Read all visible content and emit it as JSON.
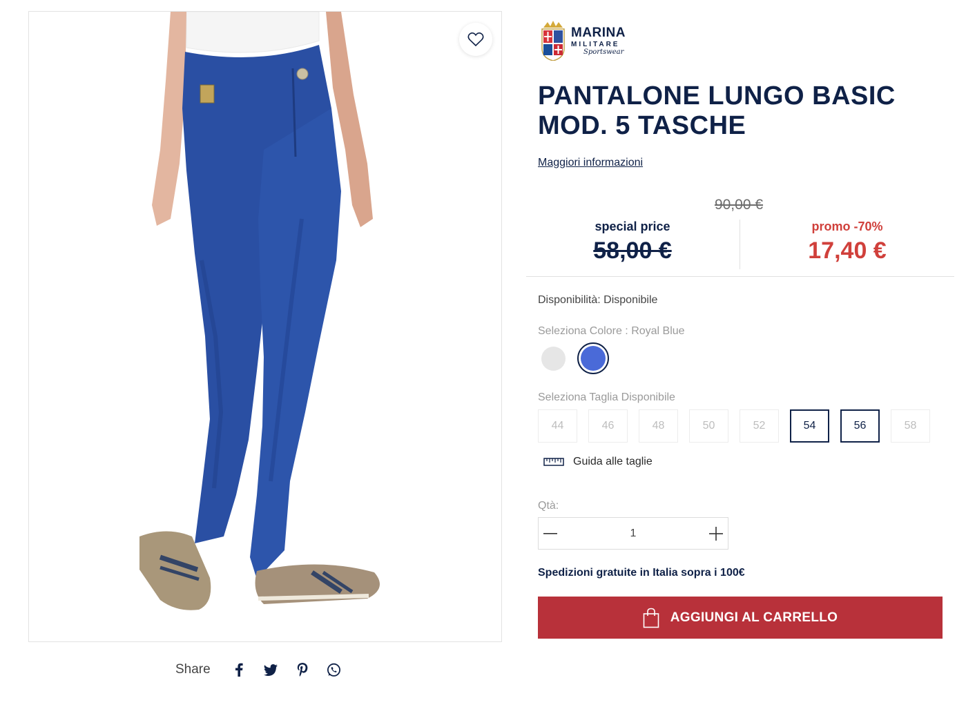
{
  "brand": {
    "line1": "MARINA",
    "line2": "MILITARE",
    "line3": "Sportswear"
  },
  "product": {
    "title": "PANTALONE LUNGO BASIC MOD. 5 TASCHE",
    "more_info": "Maggiori informazioni"
  },
  "pricing": {
    "original_price": "90,00 €",
    "special_label": "special price",
    "special_price": "58,00 €",
    "promo_label": "promo -70%",
    "promo_price": "17,40 €"
  },
  "availability": "Disponibilità: Disponibile",
  "color": {
    "label": "Seleziona Colore : Royal Blue",
    "options": [
      {
        "name": "grey",
        "hex": "#e6e6e6",
        "selected": false
      },
      {
        "name": "royal-blue",
        "hex": "#4a6ad8",
        "selected": true
      }
    ]
  },
  "sizes": {
    "label": "Seleziona Taglia Disponibile",
    "options": [
      {
        "value": "44",
        "available": false
      },
      {
        "value": "46",
        "available": false
      },
      {
        "value": "48",
        "available": false
      },
      {
        "value": "50",
        "available": false
      },
      {
        "value": "52",
        "available": false
      },
      {
        "value": "54",
        "available": true
      },
      {
        "value": "56",
        "available": true
      },
      {
        "value": "58",
        "available": false
      }
    ]
  },
  "size_guide": "Guida alle taglie",
  "quantity": {
    "label": "Qtà:",
    "value": "1"
  },
  "shipping_note": "Spedizioni gratuite in Italia sopra i 100€",
  "add_to_cart": "AGGIUNGI AL CARRELLO",
  "share": {
    "label": "Share",
    "icons": [
      "facebook-icon",
      "twitter-icon",
      "pinterest-icon",
      "whatsapp-icon"
    ]
  },
  "colors": {
    "navy": "#0f2147",
    "promo_red": "#d0403b",
    "cart_red": "#b8313a",
    "jeans_blue": "#2a4fa3"
  }
}
